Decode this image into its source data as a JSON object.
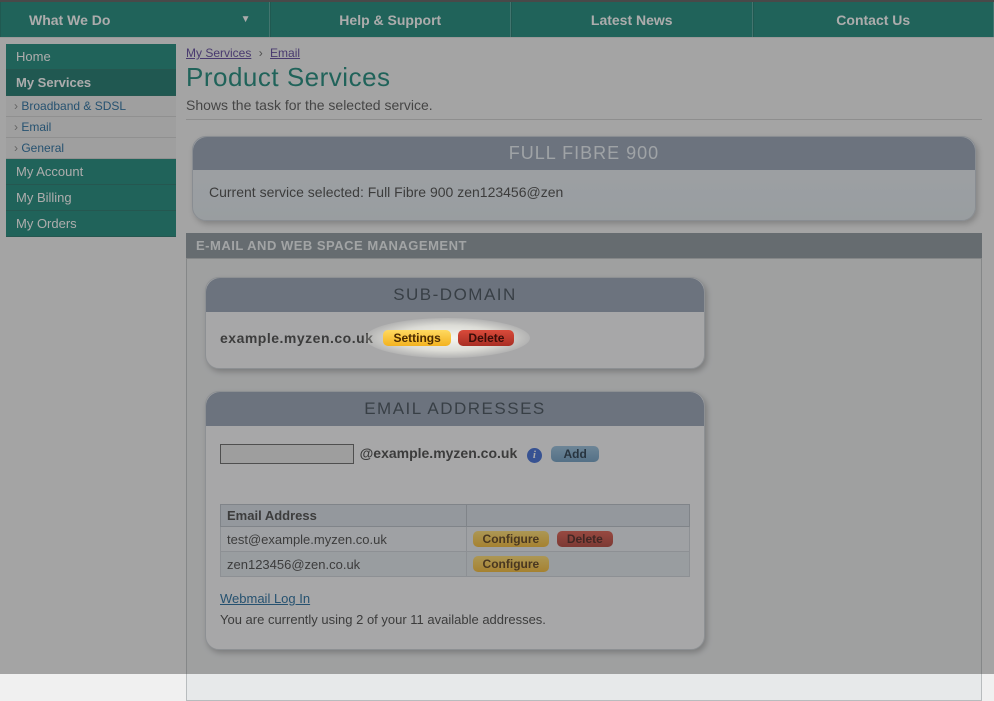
{
  "topnav": {
    "what_we_do": "What We Do",
    "help": "Help & Support",
    "news": "Latest News",
    "contact": "Contact Us"
  },
  "sidebar": {
    "home": "Home",
    "my_services": "My Services",
    "subs": {
      "broadband": "Broadband & SDSL",
      "email": "Email",
      "general": "General"
    },
    "my_account": "My Account",
    "my_billing": "My Billing",
    "my_orders": "My Orders"
  },
  "breadcrumb": {
    "a": "My Services",
    "b": "Email"
  },
  "page": {
    "title": "Product Services",
    "desc": "Shows the task for the selected service."
  },
  "service": {
    "name": "FULL FIBRE 900",
    "line": "Current service selected: Full Fibre 900 zen123456@zen"
  },
  "panel": {
    "title": "E-MAIL AND WEB SPACE MANAGEMENT"
  },
  "subdomain": {
    "head": "SUB-DOMAIN",
    "domain": "example.myzen.co.uk",
    "settings": "Settings",
    "delete": "Delete"
  },
  "emails": {
    "head": "EMAIL ADDRESSES",
    "suffix": "@example.myzen.co.uk",
    "add": "Add",
    "col": "Email Address",
    "rows": [
      {
        "addr": "test@example.myzen.co.uk",
        "configure": "Configure",
        "delete": "Delete"
      },
      {
        "addr": "zen123456@zen.co.uk",
        "configure": "Configure"
      }
    ],
    "webmail": "Webmail Log In",
    "usage": "You are currently using 2 of your 11 available addresses."
  }
}
